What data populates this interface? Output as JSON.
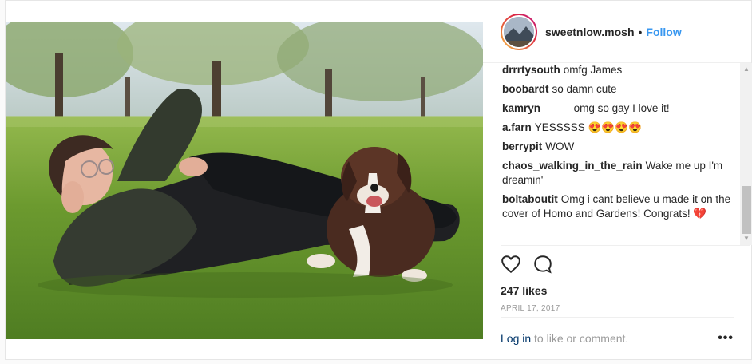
{
  "post": {
    "username": "sweetnlow.mosh",
    "separator": "•",
    "follow_label": "Follow",
    "photo_alt": "person and dog lying on grass",
    "comments": [
      {
        "user": "drrrtysouth",
        "text": "omfg James"
      },
      {
        "user": "boobardt",
        "text": "so damn cute"
      },
      {
        "user": "kamryn_____",
        "text": "omg so gay I love it!"
      },
      {
        "user": "a.farn",
        "text": "YESSSSS 😍😍😍😍"
      },
      {
        "user": "berrypit",
        "text": "WOW"
      },
      {
        "user": "chaos_walking_in_the_rain",
        "text": "Wake me up I'm dreamin'"
      },
      {
        "user": "boltaboutit",
        "text": "Omg i cant believe u made it on the cover of Homo and Gardens! Congrats! 💔"
      }
    ],
    "likes": "247 likes",
    "date": "APRIL 17, 2017",
    "login_link": "Log in",
    "login_rest": " to like or comment.",
    "more_label": "•••",
    "icons": {
      "like": "heart-icon",
      "comment": "comment-icon",
      "more": "more-options-icon"
    }
  }
}
